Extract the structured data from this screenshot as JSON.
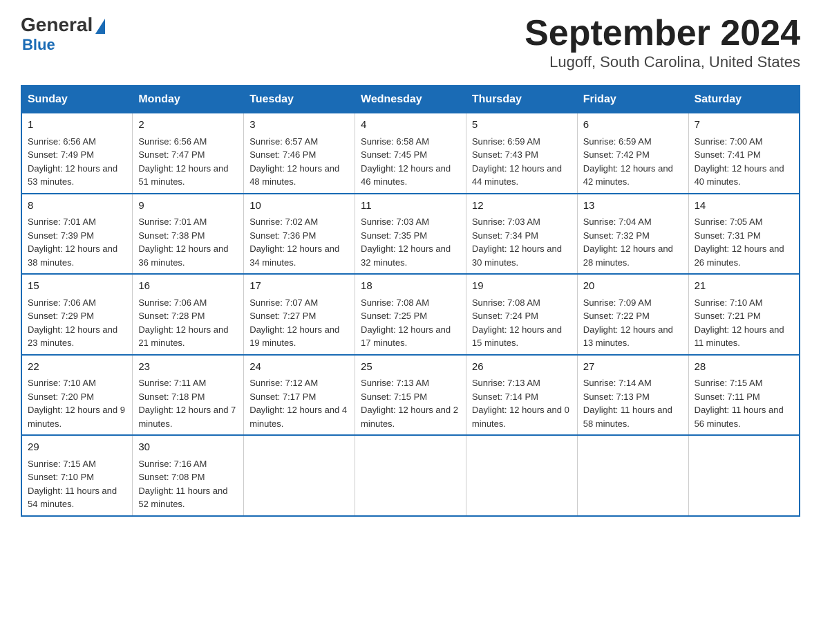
{
  "logo": {
    "text_general": "General",
    "text_blue": "Blue"
  },
  "title": {
    "month_year": "September 2024",
    "location": "Lugoff, South Carolina, United States"
  },
  "days_of_week": [
    "Sunday",
    "Monday",
    "Tuesday",
    "Wednesday",
    "Thursday",
    "Friday",
    "Saturday"
  ],
  "weeks": [
    [
      {
        "day": "1",
        "sunrise": "6:56 AM",
        "sunset": "7:49 PM",
        "daylight": "12 hours and 53 minutes."
      },
      {
        "day": "2",
        "sunrise": "6:56 AM",
        "sunset": "7:47 PM",
        "daylight": "12 hours and 51 minutes."
      },
      {
        "day": "3",
        "sunrise": "6:57 AM",
        "sunset": "7:46 PM",
        "daylight": "12 hours and 48 minutes."
      },
      {
        "day": "4",
        "sunrise": "6:58 AM",
        "sunset": "7:45 PM",
        "daylight": "12 hours and 46 minutes."
      },
      {
        "day": "5",
        "sunrise": "6:59 AM",
        "sunset": "7:43 PM",
        "daylight": "12 hours and 44 minutes."
      },
      {
        "day": "6",
        "sunrise": "6:59 AM",
        "sunset": "7:42 PM",
        "daylight": "12 hours and 42 minutes."
      },
      {
        "day": "7",
        "sunrise": "7:00 AM",
        "sunset": "7:41 PM",
        "daylight": "12 hours and 40 minutes."
      }
    ],
    [
      {
        "day": "8",
        "sunrise": "7:01 AM",
        "sunset": "7:39 PM",
        "daylight": "12 hours and 38 minutes."
      },
      {
        "day": "9",
        "sunrise": "7:01 AM",
        "sunset": "7:38 PM",
        "daylight": "12 hours and 36 minutes."
      },
      {
        "day": "10",
        "sunrise": "7:02 AM",
        "sunset": "7:36 PM",
        "daylight": "12 hours and 34 minutes."
      },
      {
        "day": "11",
        "sunrise": "7:03 AM",
        "sunset": "7:35 PM",
        "daylight": "12 hours and 32 minutes."
      },
      {
        "day": "12",
        "sunrise": "7:03 AM",
        "sunset": "7:34 PM",
        "daylight": "12 hours and 30 minutes."
      },
      {
        "day": "13",
        "sunrise": "7:04 AM",
        "sunset": "7:32 PM",
        "daylight": "12 hours and 28 minutes."
      },
      {
        "day": "14",
        "sunrise": "7:05 AM",
        "sunset": "7:31 PM",
        "daylight": "12 hours and 26 minutes."
      }
    ],
    [
      {
        "day": "15",
        "sunrise": "7:06 AM",
        "sunset": "7:29 PM",
        "daylight": "12 hours and 23 minutes."
      },
      {
        "day": "16",
        "sunrise": "7:06 AM",
        "sunset": "7:28 PM",
        "daylight": "12 hours and 21 minutes."
      },
      {
        "day": "17",
        "sunrise": "7:07 AM",
        "sunset": "7:27 PM",
        "daylight": "12 hours and 19 minutes."
      },
      {
        "day": "18",
        "sunrise": "7:08 AM",
        "sunset": "7:25 PM",
        "daylight": "12 hours and 17 minutes."
      },
      {
        "day": "19",
        "sunrise": "7:08 AM",
        "sunset": "7:24 PM",
        "daylight": "12 hours and 15 minutes."
      },
      {
        "day": "20",
        "sunrise": "7:09 AM",
        "sunset": "7:22 PM",
        "daylight": "12 hours and 13 minutes."
      },
      {
        "day": "21",
        "sunrise": "7:10 AM",
        "sunset": "7:21 PM",
        "daylight": "12 hours and 11 minutes."
      }
    ],
    [
      {
        "day": "22",
        "sunrise": "7:10 AM",
        "sunset": "7:20 PM",
        "daylight": "12 hours and 9 minutes."
      },
      {
        "day": "23",
        "sunrise": "7:11 AM",
        "sunset": "7:18 PM",
        "daylight": "12 hours and 7 minutes."
      },
      {
        "day": "24",
        "sunrise": "7:12 AM",
        "sunset": "7:17 PM",
        "daylight": "12 hours and 4 minutes."
      },
      {
        "day": "25",
        "sunrise": "7:13 AM",
        "sunset": "7:15 PM",
        "daylight": "12 hours and 2 minutes."
      },
      {
        "day": "26",
        "sunrise": "7:13 AM",
        "sunset": "7:14 PM",
        "daylight": "12 hours and 0 minutes."
      },
      {
        "day": "27",
        "sunrise": "7:14 AM",
        "sunset": "7:13 PM",
        "daylight": "11 hours and 58 minutes."
      },
      {
        "day": "28",
        "sunrise": "7:15 AM",
        "sunset": "7:11 PM",
        "daylight": "11 hours and 56 minutes."
      }
    ],
    [
      {
        "day": "29",
        "sunrise": "7:15 AM",
        "sunset": "7:10 PM",
        "daylight": "11 hours and 54 minutes."
      },
      {
        "day": "30",
        "sunrise": "7:16 AM",
        "sunset": "7:08 PM",
        "daylight": "11 hours and 52 minutes."
      },
      null,
      null,
      null,
      null,
      null
    ]
  ]
}
